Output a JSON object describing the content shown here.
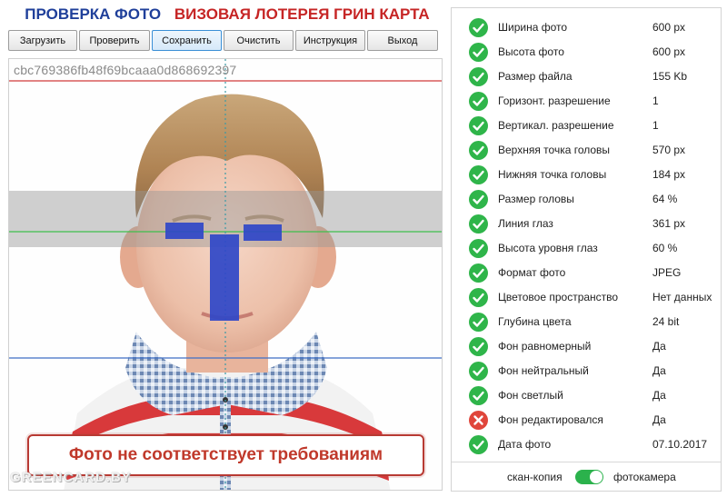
{
  "header": {
    "title_left": "ПРОВЕРКА ФОТО",
    "title_right": "ВИЗОВАЯ ЛОТЕРЕЯ ГРИН КАРТА"
  },
  "toolbar": {
    "buttons": [
      "Загрузить",
      "Проверить",
      "Сохранить",
      "Очистить",
      "Инструкция",
      "Выход"
    ],
    "active": "Сохранить"
  },
  "photo": {
    "hash": "cbc769386fb48f69bcaaa0d868692397",
    "warning": "Фото не соответствует требованиям",
    "watermark": "GREENCARD.BY"
  },
  "checks": [
    {
      "label": "Ширина фото",
      "value": "600 px",
      "status": "ok"
    },
    {
      "label": "Высота фото",
      "value": "600 px",
      "status": "ok"
    },
    {
      "label": "Размер файла",
      "value": "155 Kb",
      "status": "ok"
    },
    {
      "label": "Горизонт. разрешение",
      "value": "1",
      "status": "ok"
    },
    {
      "label": "Вертикал. разрешение",
      "value": "1",
      "status": "ok"
    },
    {
      "label": "Верхняя точка головы",
      "value": "570 px",
      "status": "ok"
    },
    {
      "label": "Нижняя точка головы",
      "value": "184 px",
      "status": "ok"
    },
    {
      "label": "Размер головы",
      "value": "64 %",
      "status": "ok"
    },
    {
      "label": "Линия глаз",
      "value": "361 px",
      "status": "ok"
    },
    {
      "label": "Высота уровня глаз",
      "value": "60 %",
      "status": "ok"
    },
    {
      "label": "Формат фото",
      "value": "JPEG",
      "status": "ok"
    },
    {
      "label": "Цветовое пространство",
      "value": "Нет данных",
      "status": "ok"
    },
    {
      "label": "Глубина цвета",
      "value": "24 bit",
      "status": "ok"
    },
    {
      "label": "Фон равномерный",
      "value": "Да",
      "status": "ok"
    },
    {
      "label": "Фон нейтральный",
      "value": "Да",
      "status": "ok"
    },
    {
      "label": "Фон светлый",
      "value": "Да",
      "status": "ok"
    },
    {
      "label": "Фон редактировался",
      "value": "Да",
      "status": "error"
    },
    {
      "label": "Дата фото",
      "value": "07.10.2017",
      "status": "ok"
    }
  ],
  "mode": {
    "left_label": "скан-копия",
    "right_label": "фотокамера",
    "state": "фотокамера"
  },
  "colors": {
    "ok": "#2fb54a",
    "error": "#e0463b",
    "title_blue": "#1f3f9a",
    "title_red": "#c62525"
  }
}
